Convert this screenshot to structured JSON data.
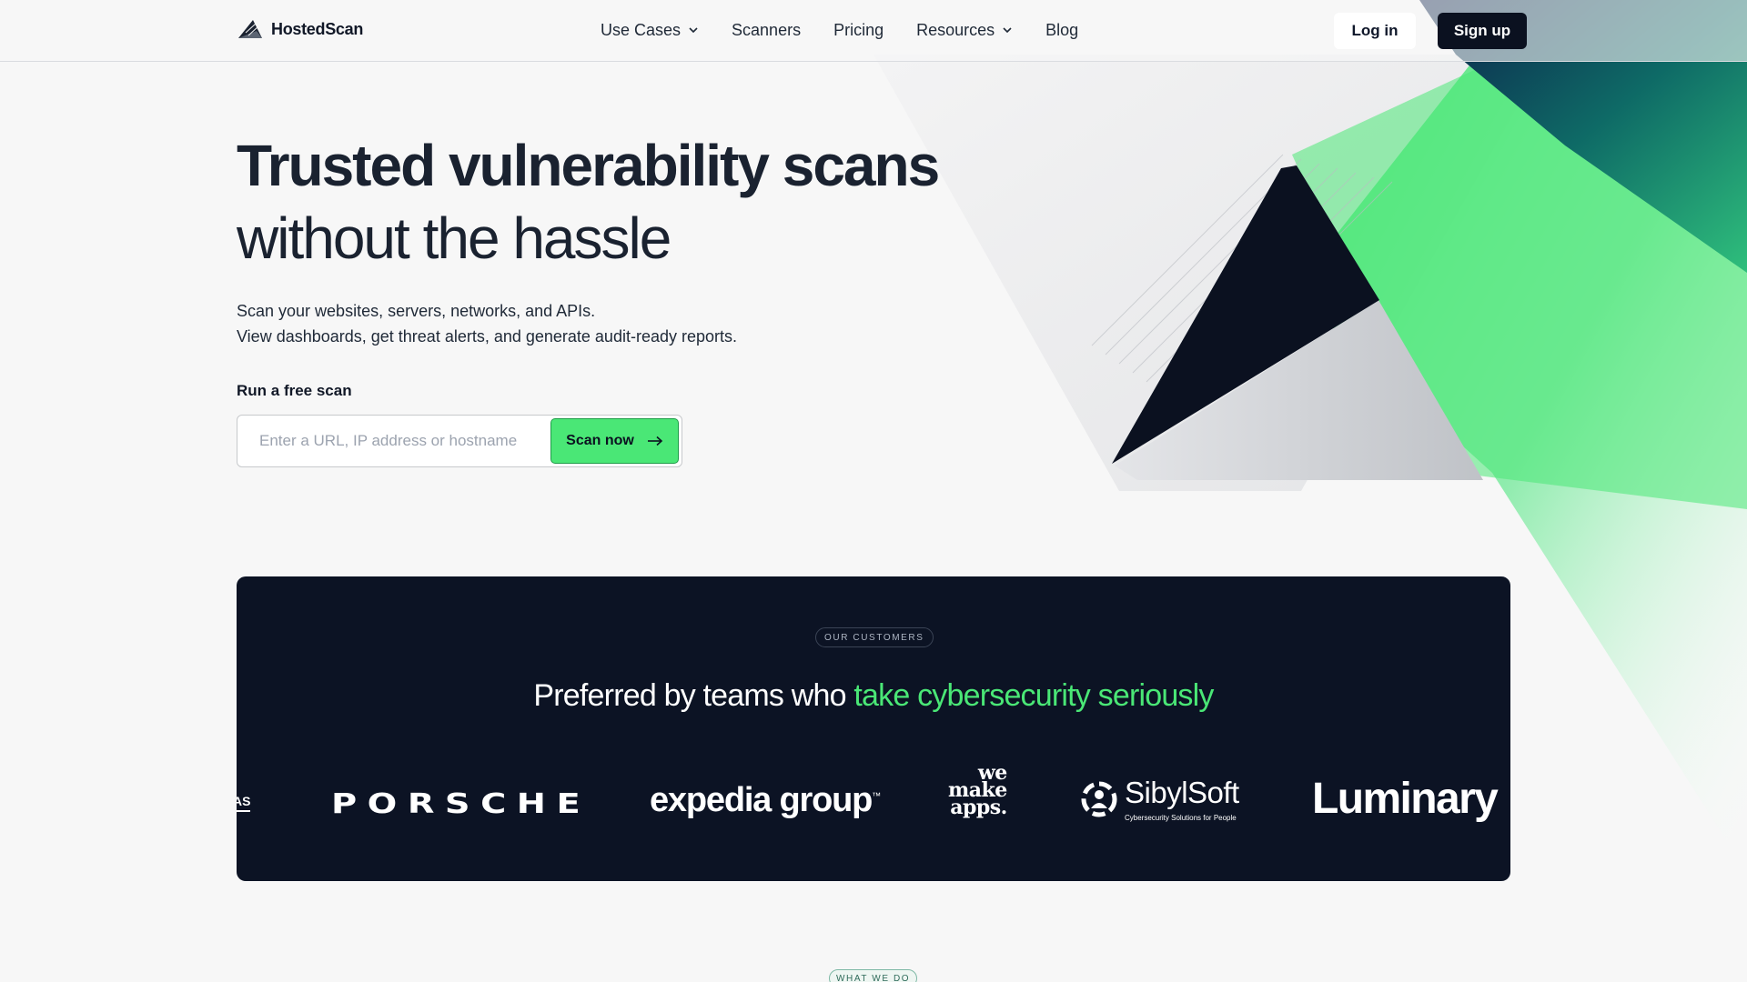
{
  "brand": {
    "name": "HostedScan"
  },
  "nav": {
    "items": [
      {
        "label": "Use Cases",
        "has_dropdown": true
      },
      {
        "label": "Scanners",
        "has_dropdown": false
      },
      {
        "label": "Pricing",
        "has_dropdown": false
      },
      {
        "label": "Resources",
        "has_dropdown": true
      },
      {
        "label": "Blog",
        "has_dropdown": false
      }
    ],
    "login_label": "Log in",
    "signup_label": "Sign up"
  },
  "hero": {
    "title_bold": "Trusted vulnerability scans",
    "title_light": "without the hassle",
    "subtitle_line1": "Scan your websites, servers, networks, and APIs.",
    "subtitle_line2": "View dashboards, get threat alerts, and generate audit-ready reports."
  },
  "scan": {
    "label": "Run a free scan",
    "input_value": "",
    "input_placeholder": "Enter a URL, IP address or hostname",
    "button_label": "Scan now"
  },
  "customers": {
    "pill": "OUR CUSTOMERS",
    "heading_prefix": "Preferred by teams who ",
    "heading_highlight": "take cybersecurity seriously",
    "logos": {
      "partial": "AS",
      "porsche": "PORSCHE",
      "expedia": "expedia group",
      "expedia_tm": "™",
      "wemake_1": "we",
      "wemake_2": "make",
      "wemake_3": "apps.",
      "sibyl_name": "SibylSoft",
      "sibyl_tag": "Cybersecurity Solutions for People",
      "luminary": "Luminary"
    }
  },
  "next_section": {
    "pill": "WHAT WE DO"
  },
  "colors": {
    "accent_green": "#4ae776",
    "dark_navy": "#0c1324",
    "background": "#f7f7f7"
  },
  "icons": [
    "hostedscan-logo-icon",
    "chevron-down-icon",
    "arrow-right-icon",
    "sibylsoft-emblem-icon"
  ]
}
